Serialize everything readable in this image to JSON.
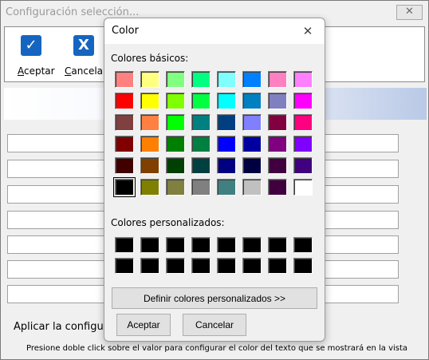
{
  "background_window": {
    "title": "Configuración selección...",
    "close_glyph": "✕",
    "toolbar": [
      {
        "icon": "checkmark-icon",
        "glyph": "✓",
        "accel": "A",
        "rest": "ceptar"
      },
      {
        "icon": "cancel-x-icon",
        "glyph": "X",
        "accel": "C",
        "rest": "ancelar"
      }
    ],
    "apply_text": "Aplicar la configuración",
    "hint_text": "Presione doble click sobre el valor para configurar el color del texto que se mostrará en la vista"
  },
  "dialog": {
    "title": "Color",
    "close_glyph": "✕",
    "basic_label": "Colores básicos:",
    "custom_label": "Colores personalizados:",
    "basic_colors": [
      "#ff8080",
      "#ffff80",
      "#80ff80",
      "#00ff80",
      "#80ffff",
      "#0080ff",
      "#ff80c0",
      "#ff80ff",
      "#ff0000",
      "#ffff00",
      "#80ff00",
      "#00ff40",
      "#00ffff",
      "#0080c0",
      "#8080c0",
      "#ff00ff",
      "#804040",
      "#ff8040",
      "#00ff00",
      "#008080",
      "#004080",
      "#8080ff",
      "#800040",
      "#ff0080",
      "#800000",
      "#ff8000",
      "#008000",
      "#008040",
      "#0000ff",
      "#0000a0",
      "#800080",
      "#8000ff",
      "#400000",
      "#804000",
      "#004000",
      "#004040",
      "#000080",
      "#000040",
      "#400040",
      "#400080",
      "#000000",
      "#808000",
      "#808040",
      "#808080",
      "#408080",
      "#c0c0c0",
      "#400040",
      "#ffffff"
    ],
    "selected_basic_index": 40,
    "custom_colors": [
      "#000000",
      "#000000",
      "#000000",
      "#000000",
      "#000000",
      "#000000",
      "#000000",
      "#000000",
      "#000000",
      "#000000",
      "#000000",
      "#000000",
      "#000000",
      "#000000",
      "#000000",
      "#000000"
    ],
    "define_button": "Definir colores personalizados >>",
    "ok_button": "Aceptar",
    "cancel_button": "Cancelar"
  }
}
